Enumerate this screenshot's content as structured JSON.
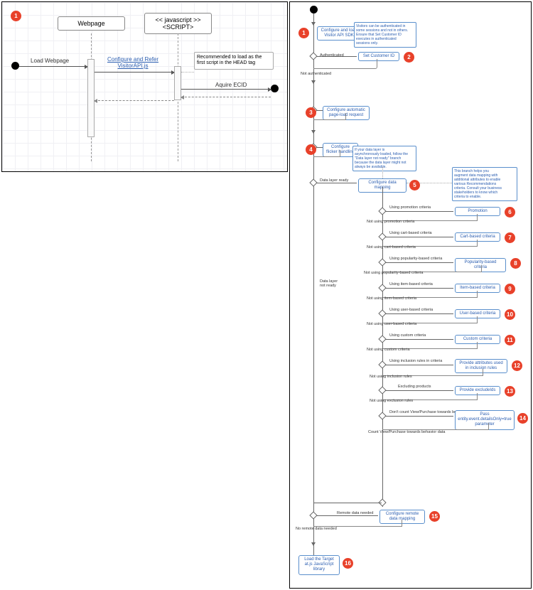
{
  "sequence": {
    "lifelines": {
      "webpage": "Webpage",
      "script": "<< javascript >>\n<SCRIPT>"
    },
    "start": "Load Webpage",
    "msg_configure": "Configure and Refer\nVisitorAPI.js",
    "msg_aquire": "Aquire ECID",
    "note_head": "Recommended to load as the\nfirst script in the HEAD tag",
    "badge": "1"
  },
  "flow": {
    "nodes": {
      "n1": "Configure and load\nVisitor API SDK",
      "n2": "Set Customer ID",
      "n3": "Configure automatic\npage-load request",
      "n4": "Configure\nflicker handling",
      "n5": "Configure data mapping",
      "n6": "Promotion",
      "n7": "Cart-based criteria",
      "n8": "Popularity-based criteria",
      "n9": "Item-based criteria",
      "n10": "User-based criteria",
      "n11": "Custom criteria",
      "n12": "Provide attributes\nused in inclusion rules",
      "n13": "Provide excludeIds",
      "n14": "Pass\nentity.event.detailsOnly=true\nparameter",
      "n15": "Configure remote\ndata mapping",
      "n16": "Load the Target\nat.js JavaScript\nlibrary"
    },
    "notes": {
      "note_auth": "Visitors can be authenticated in\nsome sessions and not in others.\nEnsure that Set Customer ID\nexecutes in authenticated\nsessions only.",
      "note_async": "If your data layer is\nasynchronously loaded, follow the\n\"Data layer not ready\" branch\nbecause the data layer might not\nalways be available.",
      "note_augment": "This branch helps you\naugment data mapping with\nadditional attributes to enable\nvarious Recommendations\ncriteria. Consult your business\nstakeholders to know which\ncriteria to enable."
    },
    "labels": {
      "auth": "Authenticated",
      "not_auth": "Not authenticated",
      "dl_ready": "Data layer ready",
      "dl_not_ready": "Data layer\nnot ready",
      "use_promo": "Using promotion criteria",
      "no_promo": "Not using promotion criteria",
      "use_cart": "Using cart-based criteria",
      "no_cart": "Not using cart-based criteria",
      "use_pop": "Using popularity-based criteria",
      "no_pop": "Not using popularity-based criteria",
      "use_item": "Using item-based criteria",
      "no_item": "Not using item-based criteria",
      "use_user": "Using user-based criteria",
      "no_user": "Not using user-based criteria",
      "use_custom": "Using custom criteria",
      "no_custom": "Not using custom criteria",
      "use_incl": "Using inclusion rules in criteria",
      "no_incl": "Not using inclusion rules",
      "excl": "Excluding products",
      "no_excl": "Not using exclusion rules",
      "no_count": "Don't count View/Purchase towards behavior data",
      "count": "Count View/Purchase towards behavior data",
      "remote": "Remote data needed",
      "no_remote": "No remote data needed"
    },
    "badges": {
      "b1": "1",
      "b2": "2",
      "b3": "3",
      "b4": "4",
      "b5": "5",
      "b6": "6",
      "b7": "7",
      "b8": "8",
      "b9": "9",
      "b10": "10",
      "b11": "11",
      "b12": "12",
      "b13": "13",
      "b14": "14",
      "b15": "15",
      "b16": "16"
    }
  }
}
